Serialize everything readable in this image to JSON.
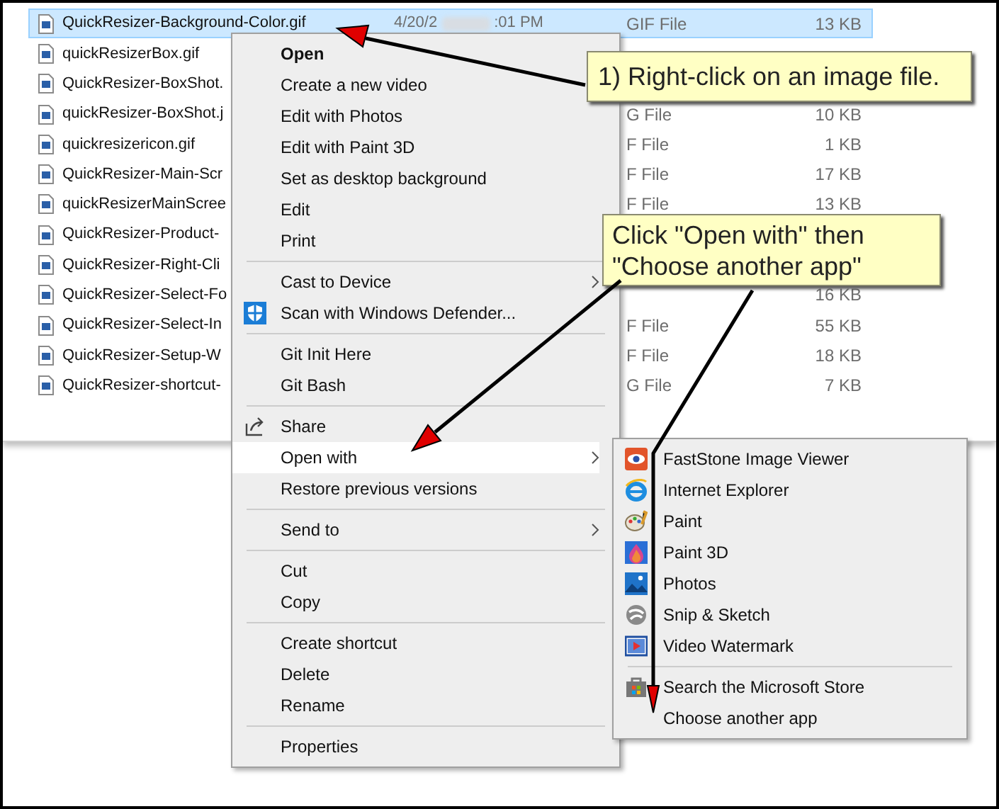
{
  "files": [
    {
      "name": "QuickResizer-Background-Color.gif",
      "selected": true,
      "date_parts": [
        "4/20/2",
        ":01 PM"
      ],
      "type": "GIF File",
      "size": "13 KB"
    },
    {
      "name": "quickResizerBox.gif",
      "selected": false
    },
    {
      "name": "QuickResizer-BoxShot.",
      "selected": false
    },
    {
      "name": "quickResizer-BoxShot.j",
      "selected": false,
      "type": "G File",
      "size": "10 KB"
    },
    {
      "name": "quickresizericon.gif",
      "selected": false,
      "type": "F File",
      "size": "1 KB"
    },
    {
      "name": "QuickResizer-Main-Scr",
      "selected": false,
      "type": "F File",
      "size": "17 KB"
    },
    {
      "name": "quickResizerMainScree",
      "selected": false,
      "type": "F File",
      "size": "13 KB"
    },
    {
      "name": "QuickResizer-Product-",
      "selected": false
    },
    {
      "name": "QuickResizer-Right-Cli",
      "selected": false
    },
    {
      "name": "QuickResizer-Select-Fo",
      "selected": false,
      "size": "16 KB"
    },
    {
      "name": "QuickResizer-Select-In",
      "selected": false,
      "type": "F File",
      "size": "55 KB"
    },
    {
      "name": "QuickResizer-Setup-W",
      "selected": false,
      "type": "F File",
      "size": "18 KB"
    },
    {
      "name": "QuickResizer-shortcut-",
      "selected": false,
      "type": "G File",
      "size": "7 KB"
    }
  ],
  "context_menu": {
    "items": [
      {
        "kind": "item",
        "label": "Open",
        "bold": true,
        "selected": false
      },
      {
        "kind": "item",
        "label": "Create a new video",
        "bold": false,
        "selected": false
      },
      {
        "kind": "item",
        "label": "Edit with Photos",
        "bold": false,
        "selected": false
      },
      {
        "kind": "item",
        "label": "Edit with Paint 3D",
        "bold": false,
        "selected": false
      },
      {
        "kind": "item",
        "label": "Set as desktop background",
        "bold": false,
        "selected": false
      },
      {
        "kind": "item",
        "label": "Edit",
        "bold": false,
        "selected": false
      },
      {
        "kind": "item",
        "label": "Print",
        "bold": false,
        "selected": false
      },
      {
        "kind": "separator"
      },
      {
        "kind": "submenu",
        "label": "Cast to Device",
        "bold": false,
        "selected": false
      },
      {
        "kind": "item",
        "label": "Scan with Windows Defender...",
        "bold": false,
        "selected": false
      },
      {
        "kind": "separator"
      },
      {
        "kind": "item",
        "label": "Git Init Here",
        "bold": false,
        "selected": false
      },
      {
        "kind": "item",
        "label": "Git Bash",
        "bold": false,
        "selected": false
      },
      {
        "kind": "separator"
      },
      {
        "kind": "item",
        "label": "Share",
        "bold": false,
        "selected": false
      },
      {
        "kind": "submenu",
        "label": "Open with",
        "bold": false,
        "selected": true
      },
      {
        "kind": "item",
        "label": "Restore previous versions",
        "bold": false,
        "selected": false
      },
      {
        "kind": "separator"
      },
      {
        "kind": "submenu",
        "label": "Send to",
        "bold": false,
        "selected": false
      },
      {
        "kind": "separator"
      },
      {
        "kind": "item",
        "label": "Cut",
        "bold": false,
        "selected": false
      },
      {
        "kind": "item",
        "label": "Copy",
        "bold": false,
        "selected": false
      },
      {
        "kind": "separator"
      },
      {
        "kind": "item",
        "label": "Create shortcut",
        "bold": false,
        "selected": false
      },
      {
        "kind": "item",
        "label": "Delete",
        "bold": false,
        "selected": false
      },
      {
        "kind": "item",
        "label": "Rename",
        "bold": false,
        "selected": false
      },
      {
        "kind": "separator"
      },
      {
        "kind": "item",
        "label": "Properties",
        "bold": false,
        "selected": false
      }
    ]
  },
  "open_with_menu": {
    "items": [
      {
        "kind": "item",
        "label": "FastStone Image Viewer"
      },
      {
        "kind": "item",
        "label": "Internet Explorer"
      },
      {
        "kind": "item",
        "label": "Paint"
      },
      {
        "kind": "item",
        "label": "Paint 3D"
      },
      {
        "kind": "item",
        "label": "Photos"
      },
      {
        "kind": "item",
        "label": "Snip & Sketch"
      },
      {
        "kind": "item",
        "label": "Video Watermark"
      },
      {
        "kind": "separator"
      },
      {
        "kind": "item",
        "label": "Search the Microsoft Store"
      },
      {
        "kind": "item",
        "label": "Choose another app"
      }
    ]
  },
  "callouts": [
    {
      "text": "1) Right-click on an image file."
    },
    {
      "text": "Click \"Open with\" then\n\"Choose another app\""
    }
  ]
}
